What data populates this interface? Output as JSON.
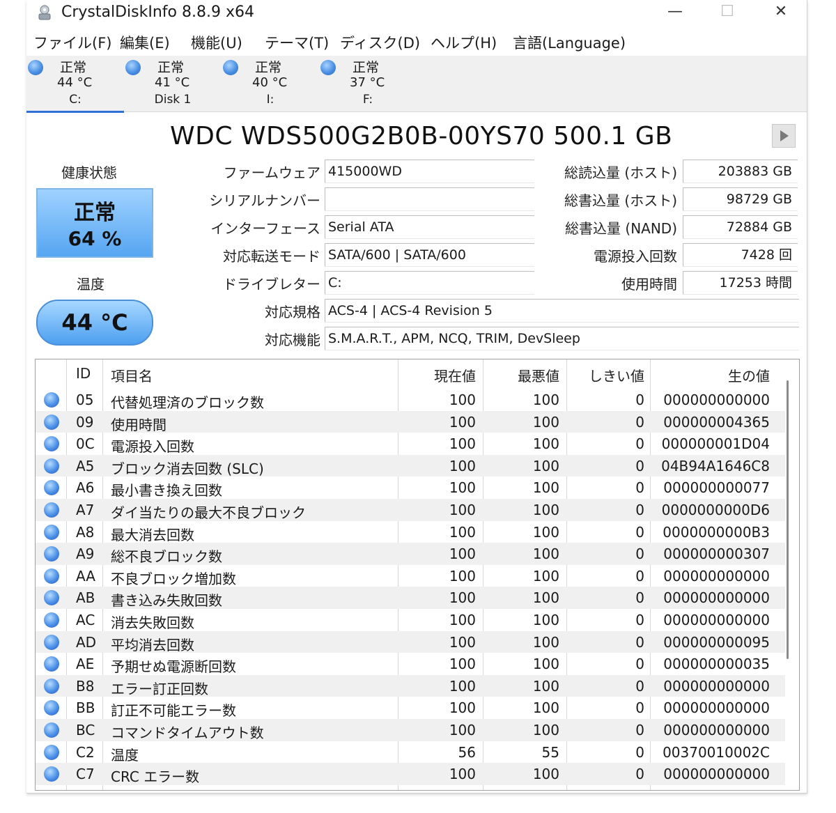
{
  "window": {
    "title": "CrystalDiskInfo 8.8.9 x64",
    "min_glyph": "—",
    "max_glyph": "☐",
    "close_glyph": "✕"
  },
  "menu": [
    "ファイル(F)",
    "編集(E)",
    "機能(U)",
    "テーマ(T)",
    "ディスク(D)",
    "ヘルプ(H)",
    "言語(Language)"
  ],
  "disks": [
    {
      "status": "正常",
      "temp": "44 °C",
      "label": "C:"
    },
    {
      "status": "正常",
      "temp": "41 °C",
      "label": "Disk 1"
    },
    {
      "status": "正常",
      "temp": "40 °C",
      "label": "I:"
    },
    {
      "status": "正常",
      "temp": "37 °C",
      "label": "F:"
    }
  ],
  "model": "WDC  WDS500G2B0B-00YS70 500.1 GB",
  "health": {
    "label": "健康状態",
    "status": "正常",
    "percent": "64 %"
  },
  "temperature": {
    "label": "温度",
    "value": "44 °C"
  },
  "info": {
    "firmware_label": "ファームウェア",
    "firmware": "415000WD",
    "serial_label": "シリアルナンバー",
    "serial": "",
    "interface_label": "インターフェース",
    "interface": "Serial ATA",
    "transfer_label": "対応転送モード",
    "transfer": "SATA/600 | SATA/600",
    "drive_label": "ドライブレター",
    "drive": "C:",
    "standard_label": "対応規格",
    "standard": "ACS-4 | ACS-4 Revision 5",
    "features_label": "対応機能",
    "features": "S.M.A.R.T., APM, NCQ, TRIM, DevSleep",
    "host_reads_label": "総読込量 (ホスト)",
    "host_reads": "203883 GB",
    "host_writes_label": "総書込量 (ホスト)",
    "host_writes": "98729 GB",
    "nand_writes_label": "総書込量 (NAND)",
    "nand_writes": "72884 GB",
    "power_count_label": "電源投入回数",
    "power_count": "7428 回",
    "power_hours_label": "使用時間",
    "power_hours": "17253 時間"
  },
  "smart_headers": {
    "id": "ID",
    "name": "項目名",
    "current": "現在値",
    "worst": "最悪値",
    "threshold": "しきい値",
    "raw": "生の値"
  },
  "smart_rows": [
    {
      "id": "05",
      "name": "代替処理済のブロック数",
      "current": "100",
      "worst": "100",
      "threshold": "0",
      "raw": "000000000000"
    },
    {
      "id": "09",
      "name": "使用時間",
      "current": "100",
      "worst": "100",
      "threshold": "0",
      "raw": "000000004365"
    },
    {
      "id": "0C",
      "name": "電源投入回数",
      "current": "100",
      "worst": "100",
      "threshold": "0",
      "raw": "000000001D04"
    },
    {
      "id": "A5",
      "name": "ブロック消去回数 (SLC)",
      "current": "100",
      "worst": "100",
      "threshold": "0",
      "raw": "04B94A1646C8"
    },
    {
      "id": "A6",
      "name": "最小書き換え回数",
      "current": "100",
      "worst": "100",
      "threshold": "0",
      "raw": "000000000077"
    },
    {
      "id": "A7",
      "name": "ダイ当たりの最大不良ブロック",
      "current": "100",
      "worst": "100",
      "threshold": "0",
      "raw": "0000000000D6"
    },
    {
      "id": "A8",
      "name": "最大消去回数",
      "current": "100",
      "worst": "100",
      "threshold": "0",
      "raw": "0000000000B3"
    },
    {
      "id": "A9",
      "name": "総不良ブロック数",
      "current": "100",
      "worst": "100",
      "threshold": "0",
      "raw": "000000000307"
    },
    {
      "id": "AA",
      "name": "不良ブロック増加数",
      "current": "100",
      "worst": "100",
      "threshold": "0",
      "raw": "000000000000"
    },
    {
      "id": "AB",
      "name": "書き込み失敗回数",
      "current": "100",
      "worst": "100",
      "threshold": "0",
      "raw": "000000000000"
    },
    {
      "id": "AC",
      "name": "消去失敗回数",
      "current": "100",
      "worst": "100",
      "threshold": "0",
      "raw": "000000000000"
    },
    {
      "id": "AD",
      "name": "平均消去回数",
      "current": "100",
      "worst": "100",
      "threshold": "0",
      "raw": "000000000095"
    },
    {
      "id": "AE",
      "name": "予期せぬ電源断回数",
      "current": "100",
      "worst": "100",
      "threshold": "0",
      "raw": "000000000035"
    },
    {
      "id": "B8",
      "name": "エラー訂正回数",
      "current": "100",
      "worst": "100",
      "threshold": "0",
      "raw": "000000000000"
    },
    {
      "id": "BB",
      "name": "訂正不可能エラー数",
      "current": "100",
      "worst": "100",
      "threshold": "0",
      "raw": "000000000000"
    },
    {
      "id": "BC",
      "name": "コマンドタイムアウト数",
      "current": "100",
      "worst": "100",
      "threshold": "0",
      "raw": "000000000000"
    },
    {
      "id": "C2",
      "name": "温度",
      "current": "56",
      "worst": "55",
      "threshold": "0",
      "raw": "00370010002C"
    },
    {
      "id": "C7",
      "name": "CRC エラー数",
      "current": "100",
      "worst": "100",
      "threshold": "0",
      "raw": "000000000000"
    }
  ]
}
